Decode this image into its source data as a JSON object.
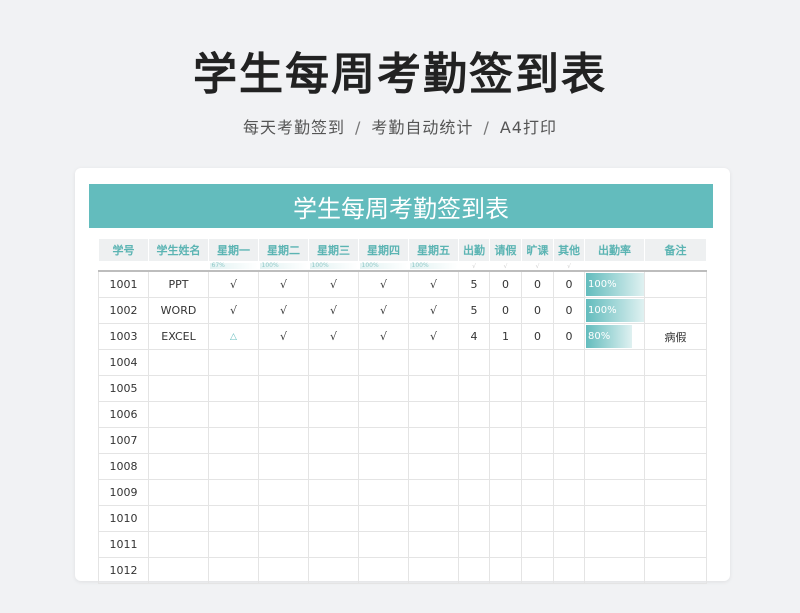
{
  "page": {
    "title": "学生每周考勤签到表",
    "subtitle_parts": [
      "每天考勤签到",
      "考勤自动统计",
      "A4打印"
    ],
    "separator": "/"
  },
  "sheet": {
    "title": "学生每周考勤签到表",
    "accent_color": "#63bcbd",
    "headers": [
      "学号",
      "学生姓名",
      "星期一",
      "星期二",
      "星期三",
      "星期四",
      "星期五",
      "出勤",
      "请假",
      "旷课",
      "其他",
      "出勤率",
      "备注"
    ],
    "daily_rates": [
      "67%",
      "100%",
      "100%",
      "100%",
      "100%"
    ],
    "marks": [
      "√",
      "△"
    ],
    "rows": [
      {
        "id": "1001",
        "name": "PPT",
        "days": [
          "√",
          "√",
          "√",
          "√",
          "√"
        ],
        "attend": "5",
        "leave": "0",
        "absent": "0",
        "other": "0",
        "rate": "100%",
        "rate_value": 1.0,
        "note": ""
      },
      {
        "id": "1002",
        "name": "WORD",
        "days": [
          "√",
          "√",
          "√",
          "√",
          "√"
        ],
        "attend": "5",
        "leave": "0",
        "absent": "0",
        "other": "0",
        "rate": "100%",
        "rate_value": 1.0,
        "note": ""
      },
      {
        "id": "1003",
        "name": "EXCEL",
        "days": [
          "△",
          "√",
          "√",
          "√",
          "√"
        ],
        "attend": "4",
        "leave": "1",
        "absent": "0",
        "other": "0",
        "rate": "80%",
        "rate_value": 0.8,
        "note": "病假"
      },
      {
        "id": "1004",
        "name": "",
        "days": [
          "",
          "",
          "",
          "",
          ""
        ],
        "attend": "",
        "leave": "",
        "absent": "",
        "other": "",
        "rate": "",
        "rate_value": 0,
        "note": ""
      },
      {
        "id": "1005",
        "name": "",
        "days": [
          "",
          "",
          "",
          "",
          ""
        ],
        "attend": "",
        "leave": "",
        "absent": "",
        "other": "",
        "rate": "",
        "rate_value": 0,
        "note": ""
      },
      {
        "id": "1006",
        "name": "",
        "days": [
          "",
          "",
          "",
          "",
          ""
        ],
        "attend": "",
        "leave": "",
        "absent": "",
        "other": "",
        "rate": "",
        "rate_value": 0,
        "note": ""
      },
      {
        "id": "1007",
        "name": "",
        "days": [
          "",
          "",
          "",
          "",
          ""
        ],
        "attend": "",
        "leave": "",
        "absent": "",
        "other": "",
        "rate": "",
        "rate_value": 0,
        "note": ""
      },
      {
        "id": "1008",
        "name": "",
        "days": [
          "",
          "",
          "",
          "",
          ""
        ],
        "attend": "",
        "leave": "",
        "absent": "",
        "other": "",
        "rate": "",
        "rate_value": 0,
        "note": ""
      },
      {
        "id": "1009",
        "name": "",
        "days": [
          "",
          "",
          "",
          "",
          ""
        ],
        "attend": "",
        "leave": "",
        "absent": "",
        "other": "",
        "rate": "",
        "rate_value": 0,
        "note": ""
      },
      {
        "id": "1010",
        "name": "",
        "days": [
          "",
          "",
          "",
          "",
          ""
        ],
        "attend": "",
        "leave": "",
        "absent": "",
        "other": "",
        "rate": "",
        "rate_value": 0,
        "note": ""
      },
      {
        "id": "1011",
        "name": "",
        "days": [
          "",
          "",
          "",
          "",
          ""
        ],
        "attend": "",
        "leave": "",
        "absent": "",
        "other": "",
        "rate": "",
        "rate_value": 0,
        "note": ""
      },
      {
        "id": "1012",
        "name": "",
        "days": [
          "",
          "",
          "",
          "",
          ""
        ],
        "attend": "",
        "leave": "",
        "absent": "",
        "other": "",
        "rate": "",
        "rate_value": 0,
        "note": ""
      }
    ]
  }
}
